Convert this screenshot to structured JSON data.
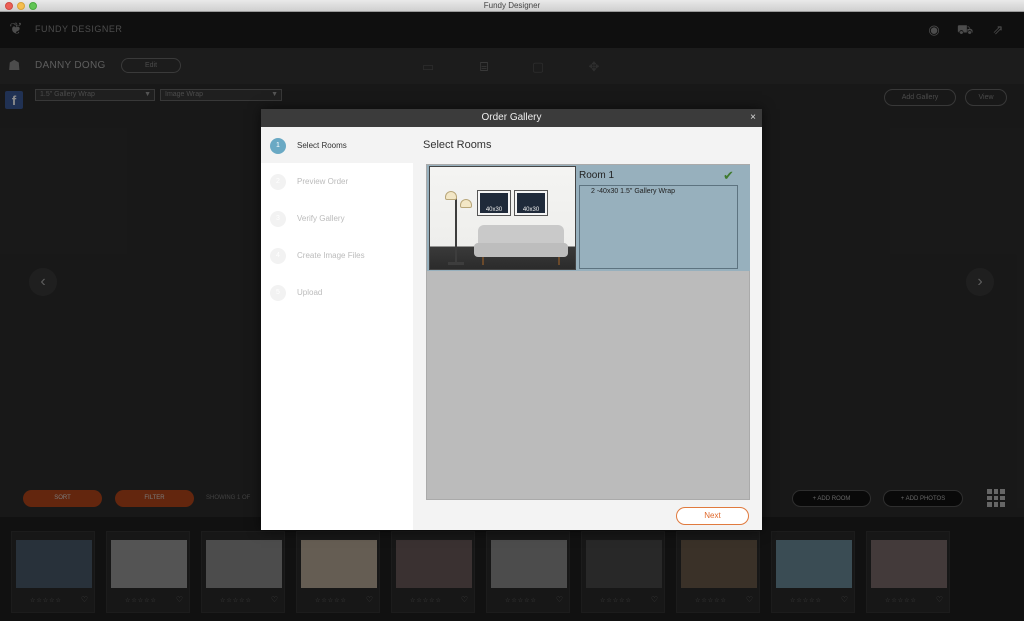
{
  "window": {
    "title": "Fundy Designer"
  },
  "app": {
    "brand": "FUNDY DESIGNER"
  },
  "header_icons": [
    "chat-icon",
    "cart-icon",
    "external-link-icon"
  ],
  "project": {
    "name": "DANNY DONG",
    "edit_label": "Edit"
  },
  "options": {
    "product_dropdown": "1.5\" Gallery Wrap",
    "wrap_dropdown": "Image Wrap",
    "add_gallery_label": "Add Gallery",
    "view_label": "View"
  },
  "bottom_toolbar": {
    "sort_label": "SORT",
    "filter_label": "FILTER",
    "showing_label": "SHOWING 1 OF",
    "add_room_label": "+ ADD ROOM",
    "add_photos_label": "+ ADD PHOTOS"
  },
  "filmstrip": {
    "stars": "☆☆☆☆☆",
    "heart": "♡",
    "colors": [
      "#4a5a6a",
      "#9a9a9a",
      "#8a8a8a",
      "#b8aa98",
      "#6a5a5a",
      "#8a8a8a",
      "#4a4a4a",
      "#6a5a4a",
      "#6a8a9a",
      "#7a6a6a"
    ]
  },
  "modal": {
    "title": "Order Gallery",
    "close": "×",
    "steps": [
      {
        "num": "1",
        "label": "Select Rooms"
      },
      {
        "num": "2",
        "label": "Preview Order"
      },
      {
        "num": "3",
        "label": "Verify Gallery"
      },
      {
        "num": "4",
        "label": "Create Image Files"
      },
      {
        "num": "5",
        "label": "Upload"
      }
    ],
    "content_title": "Select Rooms",
    "room": {
      "name": "Room 1",
      "items": [
        "2 -40x30 1.5\" Gallery Wrap"
      ],
      "art_labels": [
        "40x30",
        "40x30"
      ]
    },
    "next_label": "Next"
  }
}
